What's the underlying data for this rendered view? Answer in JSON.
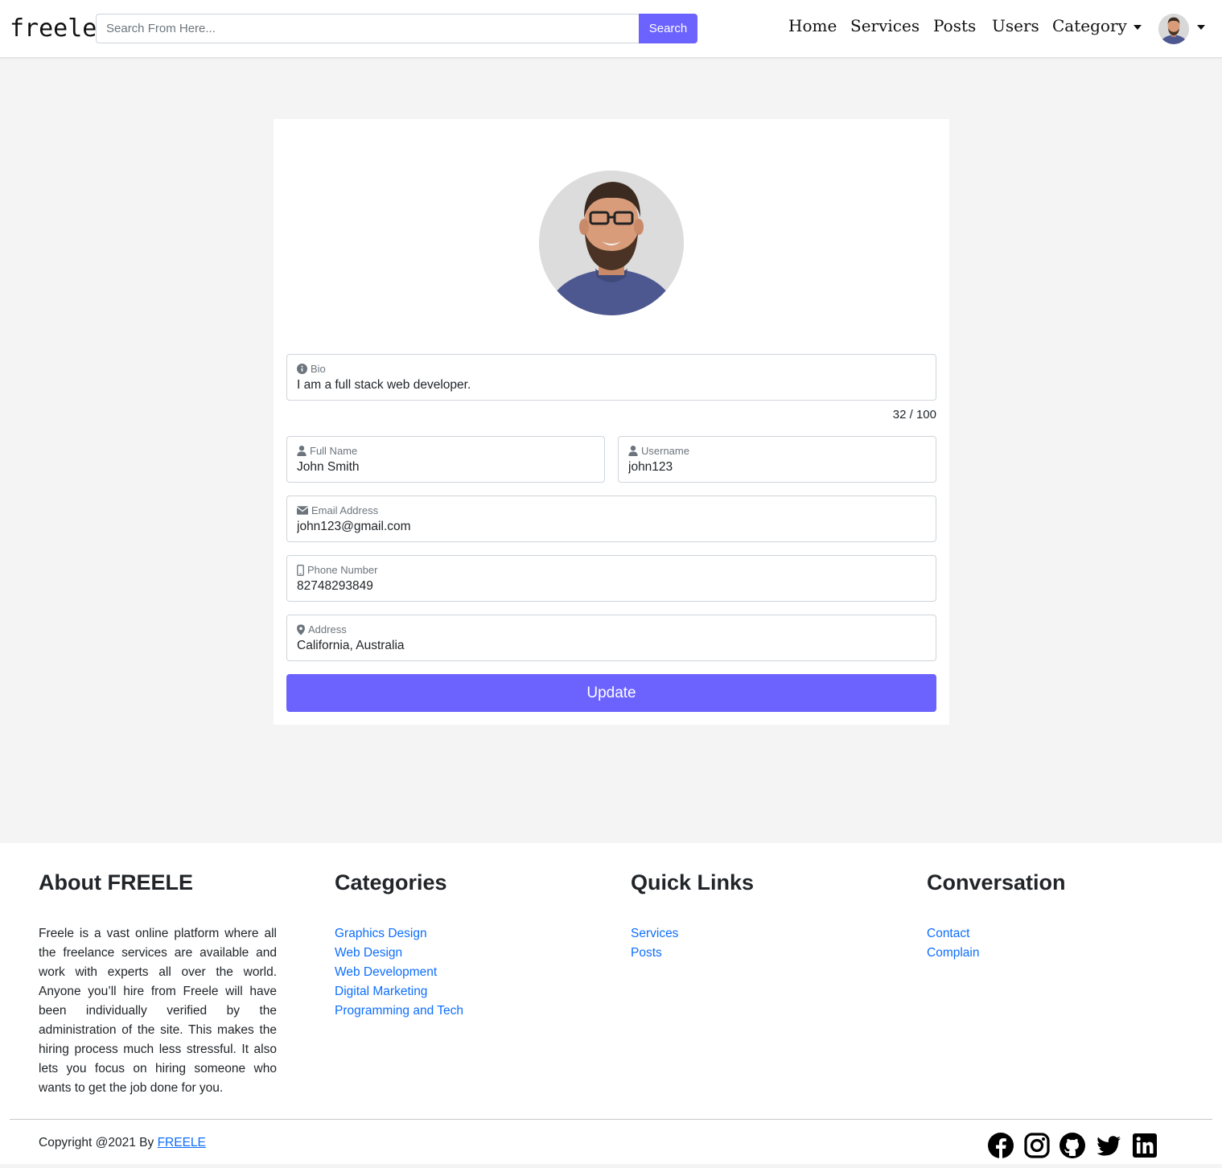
{
  "nav": {
    "brand": "freele",
    "search_placeholder": "Search From Here...",
    "search_button": "Search",
    "links": {
      "home": "Home",
      "services": "Services",
      "posts": "Posts",
      "users": "Users",
      "category": "Category"
    }
  },
  "profile": {
    "bio": {
      "label": "Bio",
      "value": "I am a full stack web developer.",
      "counter": "32 / 100"
    },
    "full_name": {
      "label": "Full Name",
      "value": "John Smith"
    },
    "username": {
      "label": "Username",
      "value": "john123"
    },
    "email": {
      "label": "Email Address",
      "value": "john123@gmail.com"
    },
    "phone": {
      "label": "Phone Number",
      "value": "82748293849"
    },
    "address": {
      "label": "Address",
      "value": "California, Australia"
    },
    "update_button": "Update"
  },
  "footer": {
    "about": {
      "title": "About FREELE",
      "text": "Freele is a vast online platform where all the freelance services are available and work with experts all over the world. Anyone you’ll hire from Freele will have been individually verified by the administration of the site. This makes the hiring process much less stressful. It also lets you focus on hiring someone who wants to get the job done for you."
    },
    "categories": {
      "title": "Categories",
      "items": [
        "Graphics Design",
        "Web Design",
        "Web Development",
        "Digital Marketing",
        "Programming and Tech"
      ]
    },
    "quick_links": {
      "title": "Quick Links",
      "items": [
        "Services",
        "Posts"
      ]
    },
    "conversation": {
      "title": "Conversation",
      "items": [
        "Contact",
        "Complain"
      ]
    },
    "copyright_prefix": "Copyright @2021 By",
    "copyright_link": "FREELE",
    "socials": [
      "facebook-icon",
      "instagram-icon",
      "github-icon",
      "twitter-icon",
      "linkedin-icon"
    ]
  },
  "colors": {
    "accent": "#6c63ff",
    "link": "#0d6efd",
    "page_bg": "#f4f4f4"
  }
}
